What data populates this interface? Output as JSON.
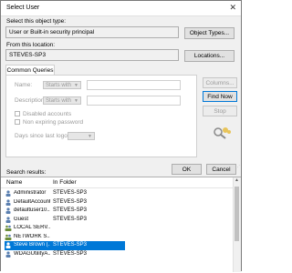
{
  "window": {
    "title": "Select User",
    "close_glyph": "✕"
  },
  "object_type": {
    "label": "Select this object type:",
    "value": "User or Built-in security principal",
    "button": "Object Types..."
  },
  "location": {
    "label": "From this location:",
    "value": "STEVES-SP3",
    "button": "Locations..."
  },
  "queries": {
    "tab": "Common Queries",
    "name_label": "Name:",
    "name_mode": "Starts with",
    "description_label": "Description:",
    "description_mode": "Starts with",
    "disabled_accounts": "Disabled accounts",
    "non_expiring_password": "Non expiring password",
    "days_label": "Days since last logon:"
  },
  "side_buttons": {
    "columns": "Columns...",
    "find_now": "Find Now",
    "stop": "Stop"
  },
  "dialog_buttons": {
    "ok": "OK",
    "cancel": "Cancel"
  },
  "results": {
    "label": "Search results:",
    "col_name": "Name",
    "col_folder": "In Folder",
    "rows": [
      {
        "name": "Administrator",
        "folder": "STEVES-SP3",
        "icon": "user-icon",
        "selected": false
      },
      {
        "name": "DefaultAccount",
        "folder": "STEVES-SP3",
        "icon": "user-icon",
        "selected": false
      },
      {
        "name": "defaultuser10...",
        "folder": "STEVES-SP3",
        "icon": "user-icon",
        "selected": false
      },
      {
        "name": "Guest",
        "folder": "STEVES-SP3",
        "icon": "user-icon",
        "selected": false
      },
      {
        "name": "LOCAL SERV...",
        "folder": "",
        "icon": "group-icon",
        "selected": false
      },
      {
        "name": "NETWORK S...",
        "folder": "",
        "icon": "group-icon",
        "selected": false
      },
      {
        "name": "Steve Brown (...",
        "folder": "STEVES-SP3",
        "icon": "user-icon",
        "selected": true
      },
      {
        "name": "WDAGUtilityA...",
        "folder": "STEVES-SP3",
        "icon": "user-icon",
        "selected": false
      }
    ]
  },
  "colors": {
    "selection": "#0078d7",
    "window_bg": "#f0f0f0"
  }
}
